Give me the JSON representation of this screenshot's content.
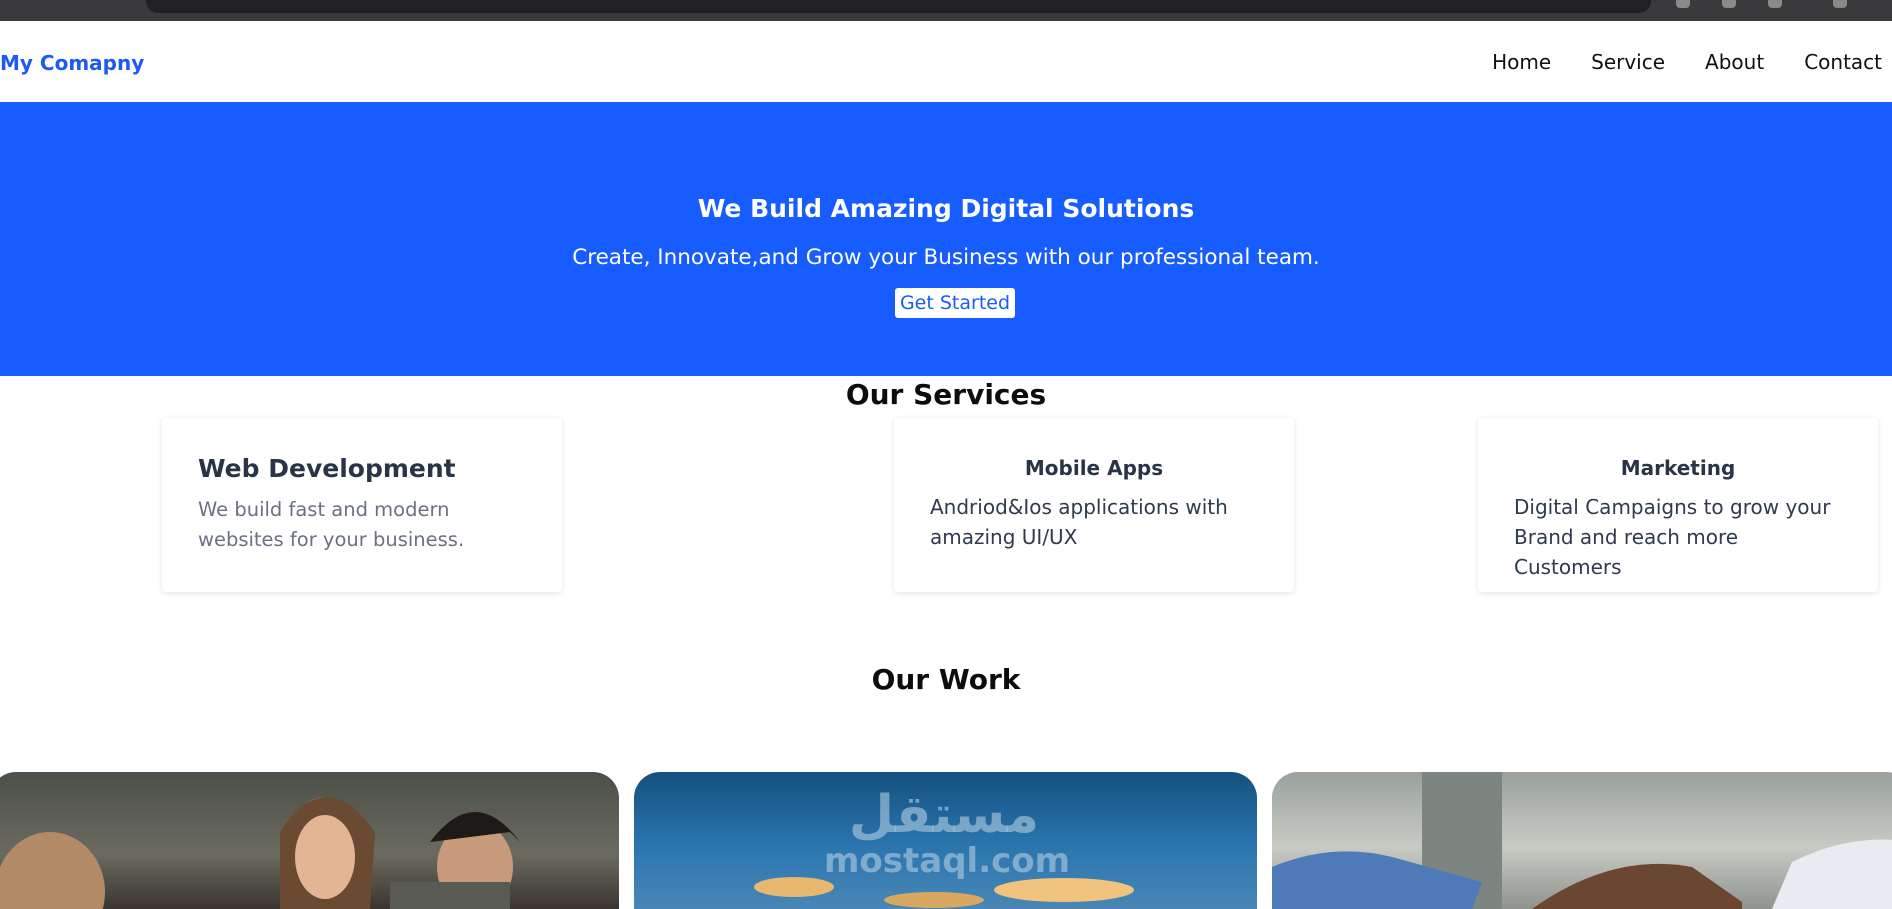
{
  "brand": {
    "name": "My Comapny"
  },
  "nav": {
    "items": [
      "Home",
      "Service",
      "About",
      "Contact"
    ]
  },
  "hero": {
    "title": "We Build Amazing Digital Solutions",
    "subtitle": "Create, Innovate,and Grow your Business with our professional team.",
    "cta_label": "Get Started"
  },
  "services": {
    "title": "Our Services",
    "items": [
      {
        "title": "Web Development",
        "text": "We build fast and modern websites for your business."
      },
      {
        "title": "Mobile Apps",
        "text": "Andriod&Ios applications with amazing UI/UX"
      },
      {
        "title": "Marketing",
        "text": "Digital Campaigns to grow your Brand and reach more Customers"
      }
    ]
  },
  "work": {
    "title": "Our Work",
    "watermark": {
      "arabic": "مستقل",
      "latin": "mostaql.com"
    }
  },
  "colors": {
    "accent": "#175cff",
    "brand": "#1d5af5"
  }
}
